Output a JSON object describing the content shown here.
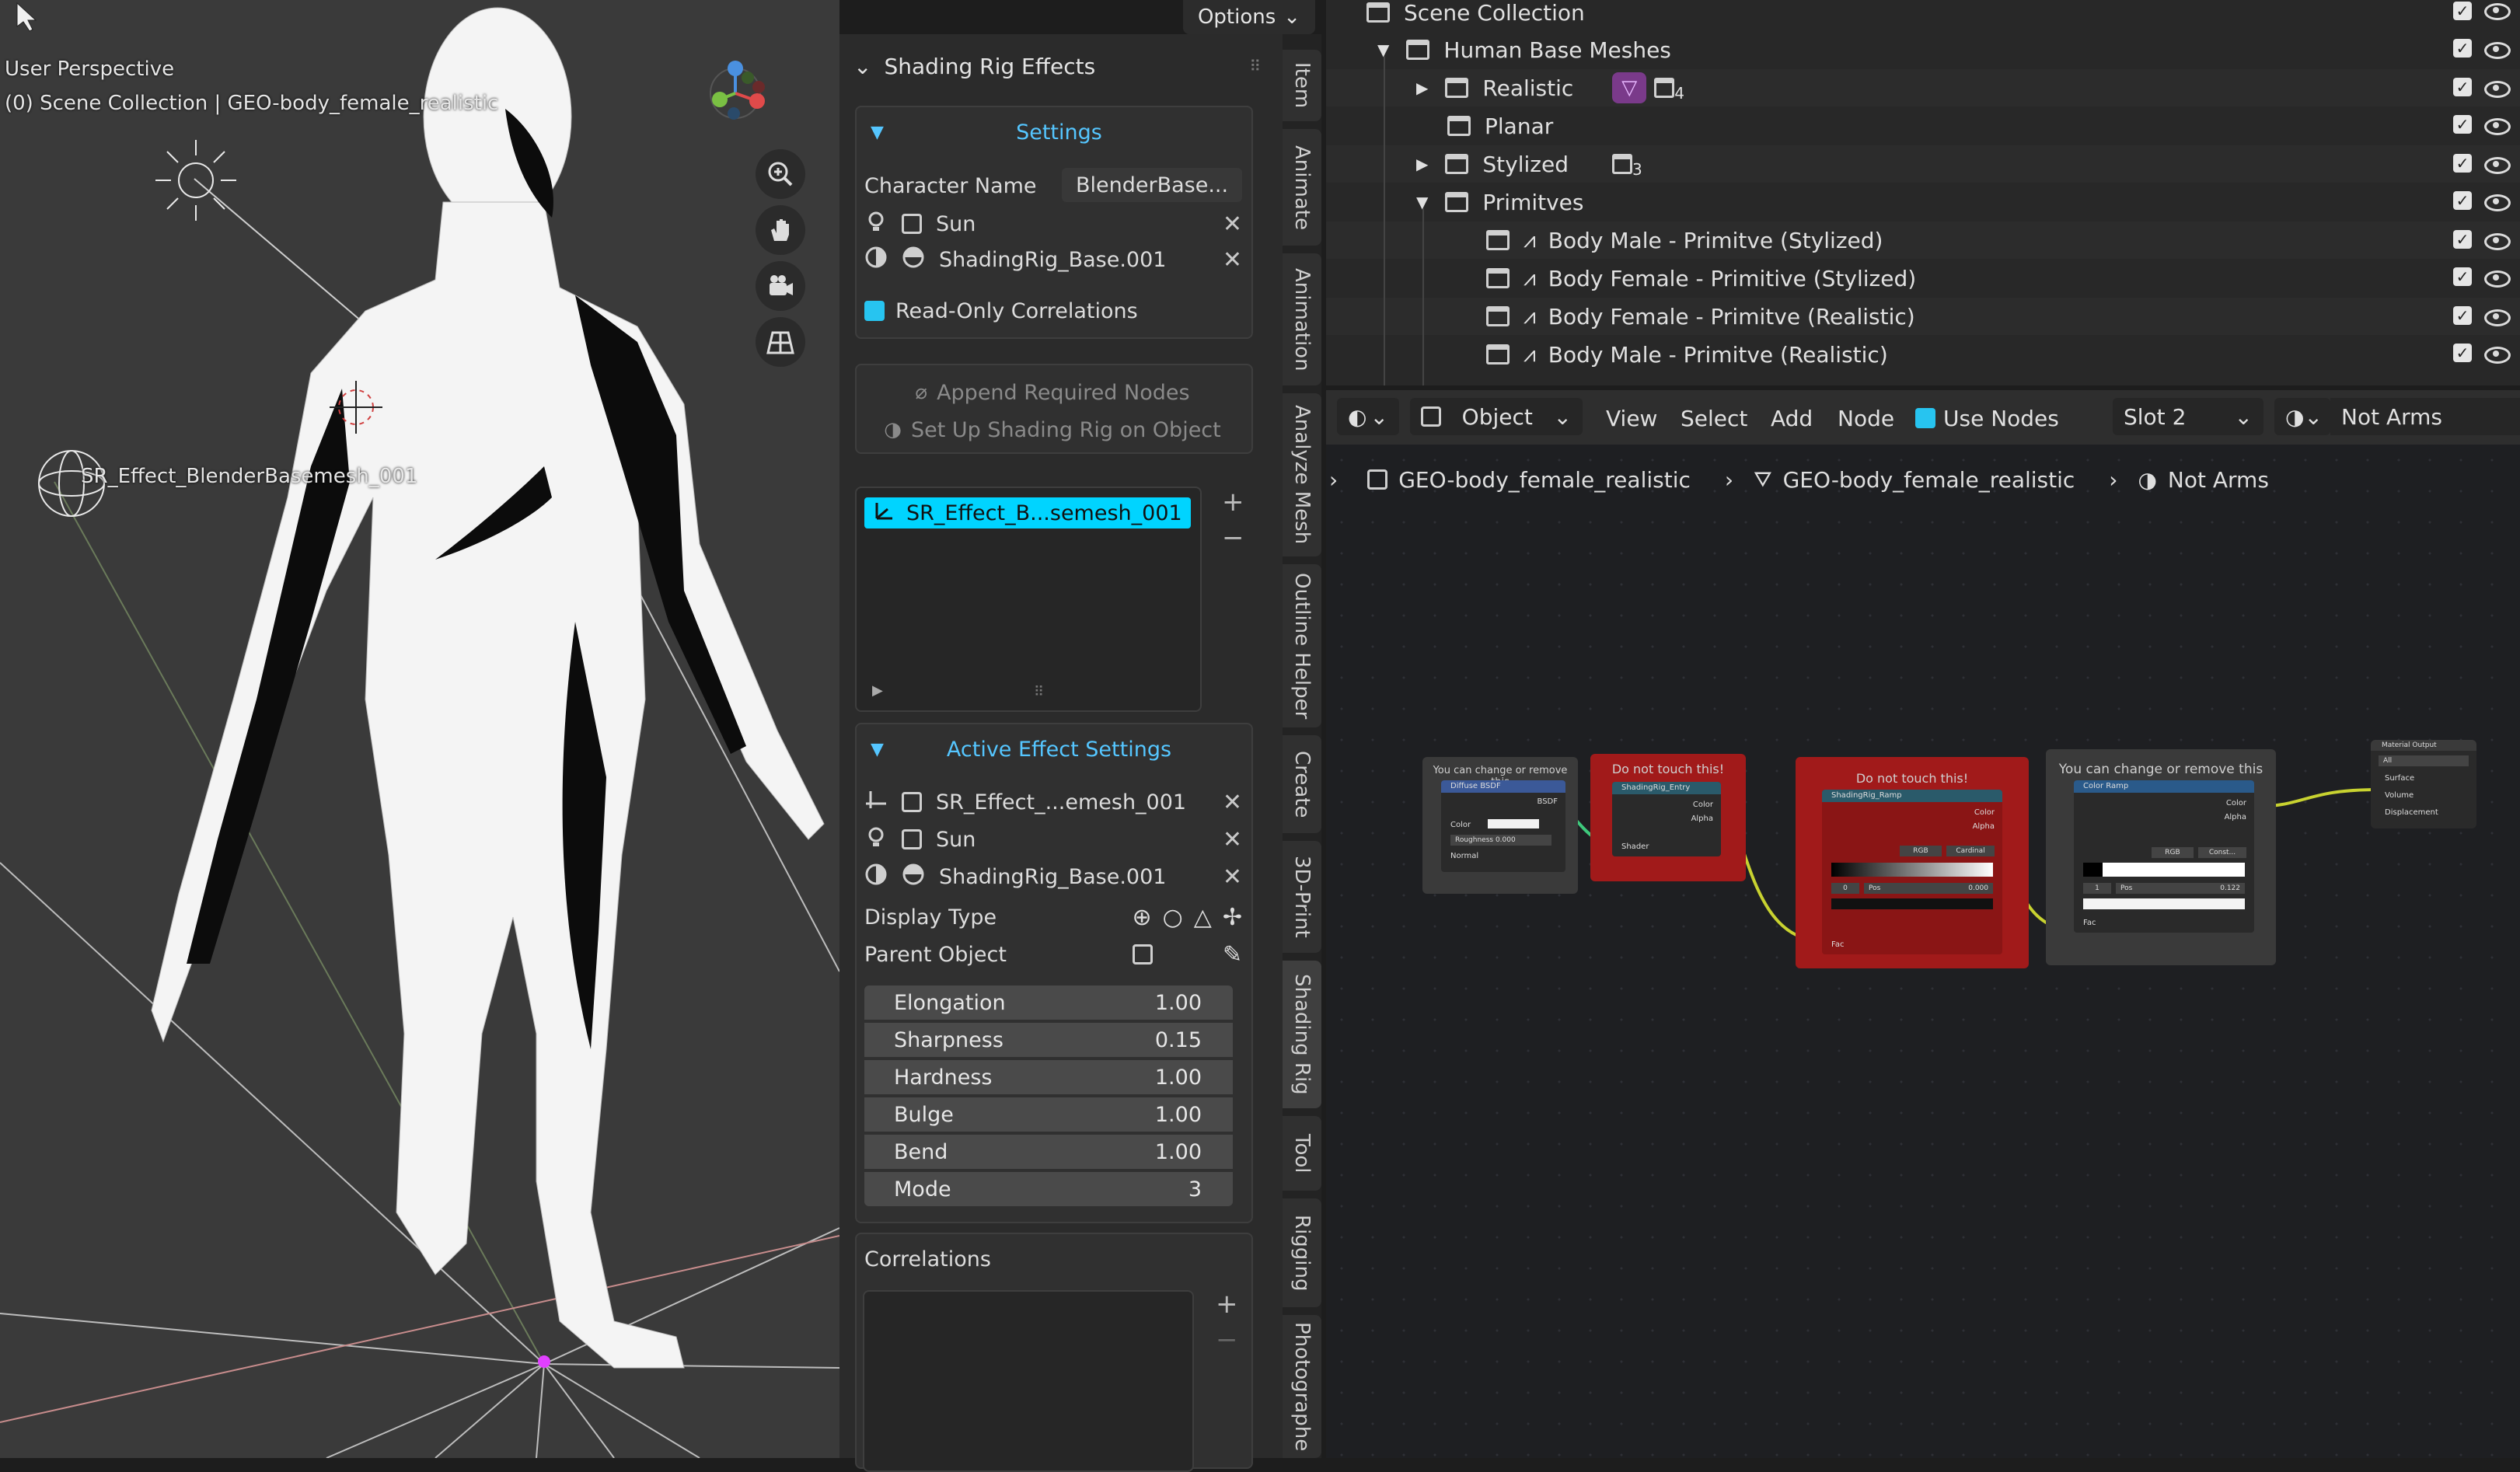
{
  "viewport": {
    "perspective_label": "User Perspective",
    "collection_label": "(0) Scene Collection | GEO-body_female_realistic",
    "empty_label": "SR_Effect_BlenderBasemesh_001",
    "options_label": "Options",
    "axis_labels": [
      "X",
      "Y",
      "Z"
    ]
  },
  "npanel": {
    "title": "Shading Rig Effects",
    "settings": {
      "header": "Settings",
      "character_name_label": "Character Name",
      "character_name_value": "BlenderBase...",
      "light_value": "Sun",
      "material_value": "ShadingRig_Base.001",
      "read_only_label": "Read-Only Correlations"
    },
    "append_nodes_label": "Append Required Nodes",
    "setup_label": "Set Up Shading Rig on Object",
    "effects_list": [
      "SR_Effect_B...semesh_001"
    ],
    "active_effect": {
      "header": "Active Effect Settings",
      "effect_value": "SR_Effect_...emesh_001",
      "light_value": "Sun",
      "material_value": "ShadingRig_Base.001",
      "display_type_label": "Display Type",
      "parent_object_label": "Parent Object",
      "sliders": [
        {
          "label": "Elongation",
          "value": "1.00"
        },
        {
          "label": "Sharpness",
          "value": "0.15"
        },
        {
          "label": "Hardness",
          "value": "1.00"
        },
        {
          "label": "Bulge",
          "value": "1.00"
        },
        {
          "label": "Bend",
          "value": "1.00"
        },
        {
          "label": "Mode",
          "value": "3"
        }
      ]
    },
    "correlations_label": "Correlations"
  },
  "tabs": [
    "Item",
    "Animate",
    "Animation",
    "Analyze Mesh",
    "Outline Helper",
    "Create",
    "3D-Print",
    "Shading Rig",
    "Tool",
    "Rigging",
    "Photographe"
  ],
  "outliner": {
    "rows": [
      {
        "label": "Scene Collection",
        "count": ""
      },
      {
        "label": "Human Base Meshes",
        "count": ""
      },
      {
        "label": "Realistic",
        "count": "4"
      },
      {
        "label": "Planar",
        "count": ""
      },
      {
        "label": "Stylized",
        "count": "3"
      },
      {
        "label": "Primitves",
        "count": ""
      },
      {
        "label": "Body Male - Primitve (Stylized)",
        "count": ""
      },
      {
        "label": "Body Female - Primitive (Stylized)",
        "count": ""
      },
      {
        "label": "Body Female - Primitve (Realistic)",
        "count": ""
      },
      {
        "label": "Body Male - Primitve (Realistic)",
        "count": ""
      }
    ]
  },
  "node_header": {
    "mode": "Object",
    "menus": [
      "View",
      "Select",
      "Add",
      "Node"
    ],
    "use_nodes_label": "Use Nodes",
    "slot": "Slot 2",
    "material": "Not Arms"
  },
  "breadcrumb": [
    "GEO-body_female_realistic",
    "GEO-body_female_realistic",
    "Not Arms"
  ],
  "nodes": {
    "frame1_label": "You can change or remove this",
    "frame2_label": "Do not touch this!",
    "frame3_label": "Do not touch this!",
    "frame4_label": "You can change or remove this",
    "diffuse_title": "Diffuse BSDF",
    "diffuse_out": "BSDF",
    "diffuse_inputs": [
      "Color",
      "Roughness  0.000",
      "Normal"
    ],
    "entry_title": "ShadingRig_Entry",
    "entry_outputs": [
      "Color",
      "Alpha"
    ],
    "entry_input": "Shader",
    "ramp_title": "ShadingRig_Ramp",
    "ramp_outputs": [
      "Color",
      "Alpha"
    ],
    "ramp_mode": "RGB",
    "ramp_interp": "Cardinal",
    "ramp_pos_index": "0",
    "ramp_pos_label": "Pos",
    "ramp_pos_value": "0.000",
    "ramp_input": "Fac",
    "colorramp_title": "Color Ramp",
    "colorramp_outputs": [
      "Color",
      "Alpha"
    ],
    "colorramp_mode": "RGB",
    "colorramp_interp": "Const...",
    "colorramp_pos_index": "1",
    "colorramp_pos_label": "Pos",
    "colorramp_pos_value": "0.122",
    "colorramp_input": "Fac",
    "output_title": "Material Output",
    "output_target": "All",
    "output_inputs": [
      "Surface",
      "Volume",
      "Displacement"
    ]
  },
  "colors": {
    "accent_blue": "#55c6ff",
    "selection_cyan": "#00d4ff",
    "warning_red": "#a11a1a"
  }
}
